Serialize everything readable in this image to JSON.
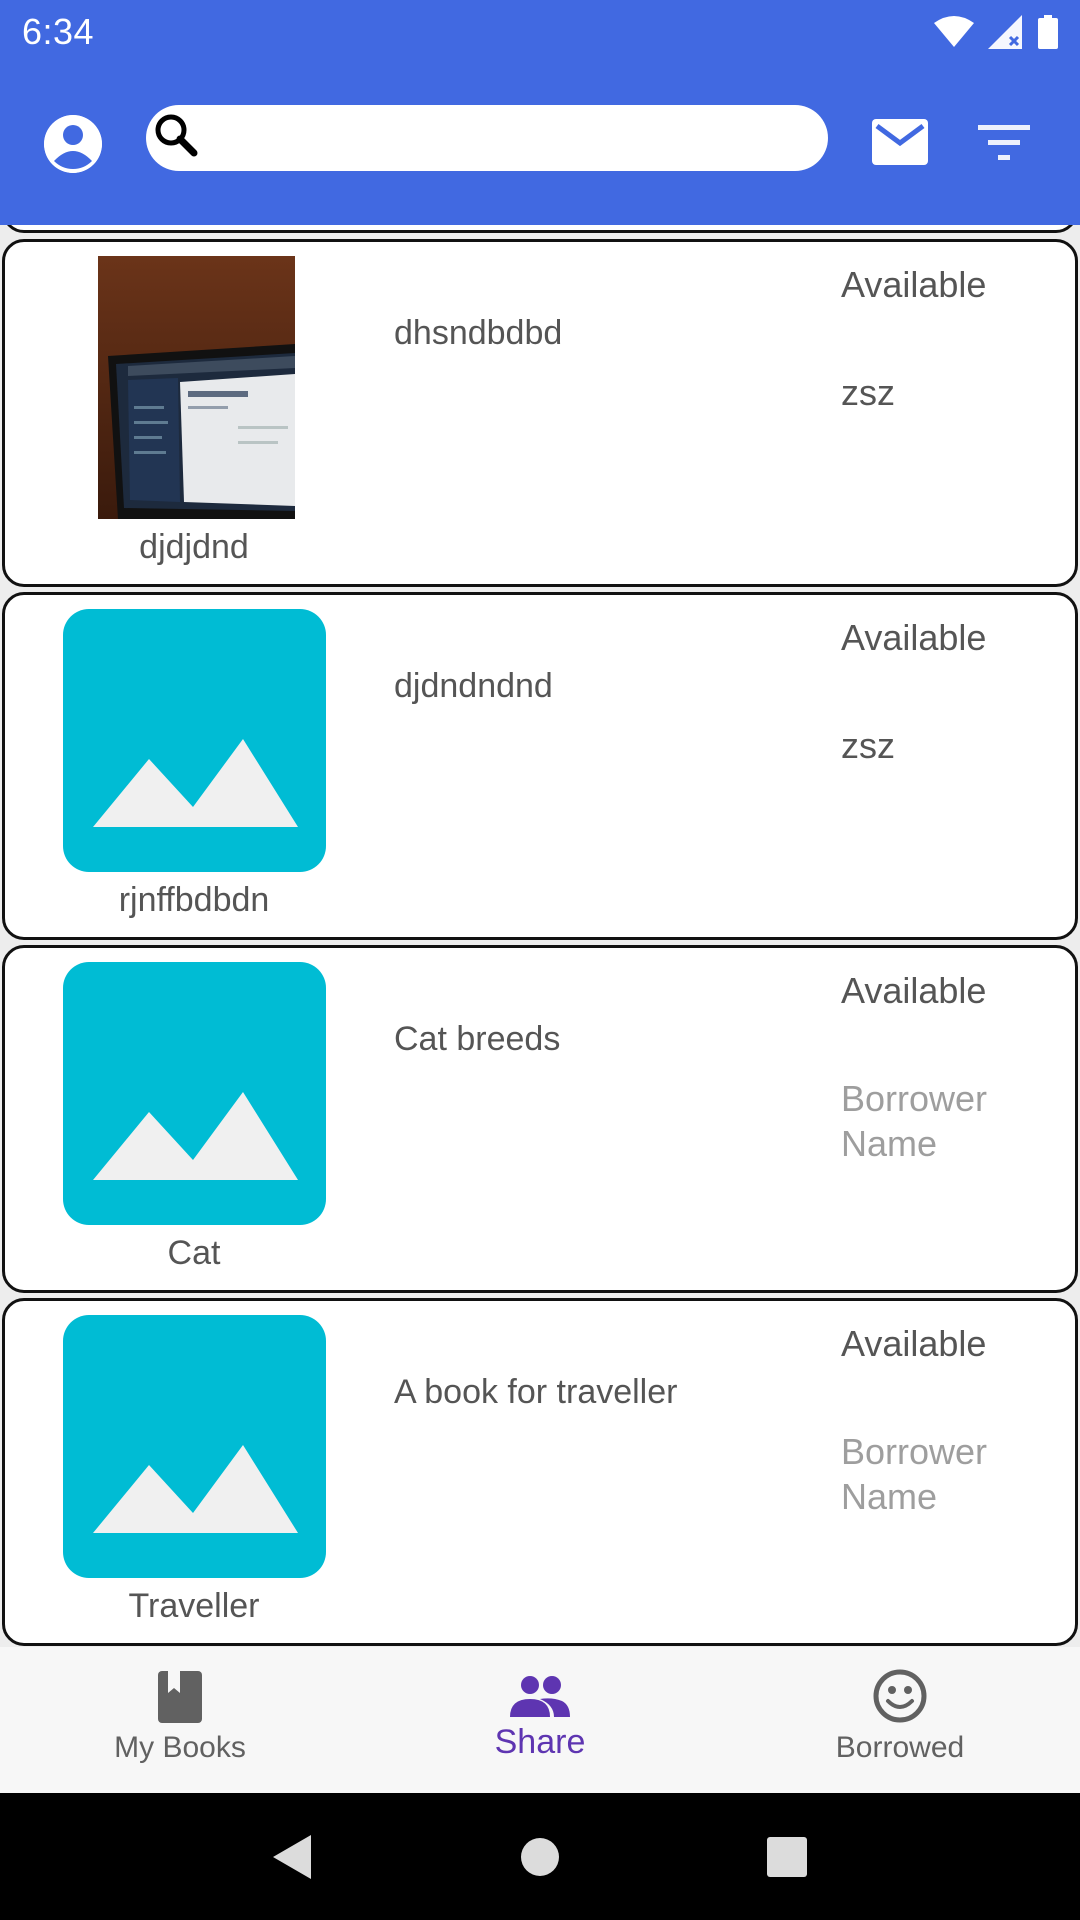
{
  "status_bar": {
    "time": "6:34"
  },
  "search": {
    "value": "",
    "placeholder": ""
  },
  "books": [
    {
      "title": "djdjdnd",
      "description": "dhsndbdbd",
      "status": "Available",
      "borrower": "zsz",
      "borrower_is_hint": false,
      "image": "photo"
    },
    {
      "title": "rjnffbdbdn",
      "description": "djdndndnd",
      "status": "Available",
      "borrower": "zsz",
      "borrower_is_hint": false,
      "image": "placeholder"
    },
    {
      "title": "Cat",
      "description": "Cat breeds",
      "status": "Available",
      "borrower": "Borrower Name",
      "borrower_is_hint": true,
      "image": "placeholder"
    },
    {
      "title": "Traveller",
      "description": "A book for traveller",
      "status": "Available",
      "borrower": "Borrower Name",
      "borrower_is_hint": true,
      "image": "placeholder"
    }
  ],
  "bottom_nav": {
    "items": [
      {
        "label": "My Books",
        "icon": "book-icon",
        "active": false
      },
      {
        "label": "Share",
        "icon": "people-icon",
        "active": true
      },
      {
        "label": "Borrowed",
        "icon": "smiley-icon",
        "active": false
      }
    ]
  },
  "colors": {
    "primary": "#4169e1",
    "accent": "#5e35b1",
    "placeholder": "#00bcd4"
  }
}
